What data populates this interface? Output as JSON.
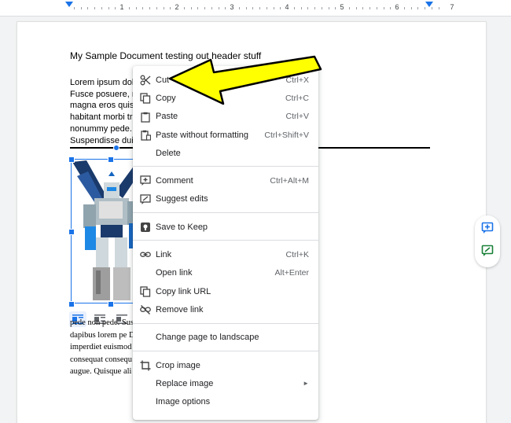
{
  "ruler": {
    "numbers": [
      "1",
      "2",
      "3",
      "4",
      "5",
      "6",
      "7"
    ]
  },
  "document": {
    "title": "My Sample Document testing out header stuff",
    "paragraph1": [
      "Lorem ipsum dolo                                                s porttitor congue massa.",
      "Fusce posuere, n                                                da libero, sit amet commodo",
      "magna eros quis                                                 amus a tellus. Pellentesque",
      "habitant morbi tri                                              gris egestas. Proin pharetra",
      "nonummy pede. I                                                 ec laoreet nonummy augue.",
      "Suspendisse dui                                                 tis, nunc."
    ],
    "paragraph2": [
      "                                                                pede non pede. Suspendisse",
      "dapibus lorem pe                                                Donec hendrerit, felis et",
      "imperdiet euismod                                               apien. Donec ut est in lectus",
      "consequat consequ                                               in nunc porta tristique. Proin nec",
      "augue. Quisque ali                                              sdpon check"
    ]
  },
  "context_menu": {
    "group1": [
      {
        "label": "Cut",
        "shortcut": "Ctrl+X",
        "icon": "scissors-icon"
      },
      {
        "label": "Copy",
        "shortcut": "Ctrl+C",
        "icon": "copy-icon"
      },
      {
        "label": "Paste",
        "shortcut": "Ctrl+V",
        "icon": "clipboard-icon"
      },
      {
        "label": "Paste without formatting",
        "shortcut": "Ctrl+Shift+V",
        "icon": "paste-plain-icon"
      },
      {
        "label": "Delete",
        "shortcut": "",
        "icon": ""
      }
    ],
    "group2": [
      {
        "label": "Comment",
        "shortcut": "Ctrl+Alt+M",
        "icon": "comment-add-icon"
      },
      {
        "label": "Suggest edits",
        "shortcut": "",
        "icon": "suggest-edit-icon"
      }
    ],
    "group3": [
      {
        "label": "Save to Keep",
        "shortcut": "",
        "icon": "keep-icon"
      }
    ],
    "group4": [
      {
        "label": "Link",
        "shortcut": "Ctrl+K",
        "icon": "link-icon"
      },
      {
        "label": "Open link",
        "shortcut": "Alt+Enter",
        "icon": ""
      },
      {
        "label": "Copy link URL",
        "shortcut": "",
        "icon": "copy-icon"
      },
      {
        "label": "Remove link",
        "shortcut": "",
        "icon": "link-off-icon"
      }
    ],
    "group5": [
      {
        "label": "Change page to landscape",
        "shortcut": "",
        "icon": ""
      }
    ],
    "group6": [
      {
        "label": "Crop image",
        "shortcut": "",
        "icon": "crop-icon"
      },
      {
        "label": "Replace image",
        "shortcut": "",
        "icon": "",
        "submenu": "►"
      },
      {
        "label": "Image options",
        "shortcut": "",
        "icon": ""
      }
    ]
  },
  "colors": {
    "accent": "#1a73e8",
    "side_icon_green": "#188038",
    "annotation_arrow": "#ffff00"
  }
}
